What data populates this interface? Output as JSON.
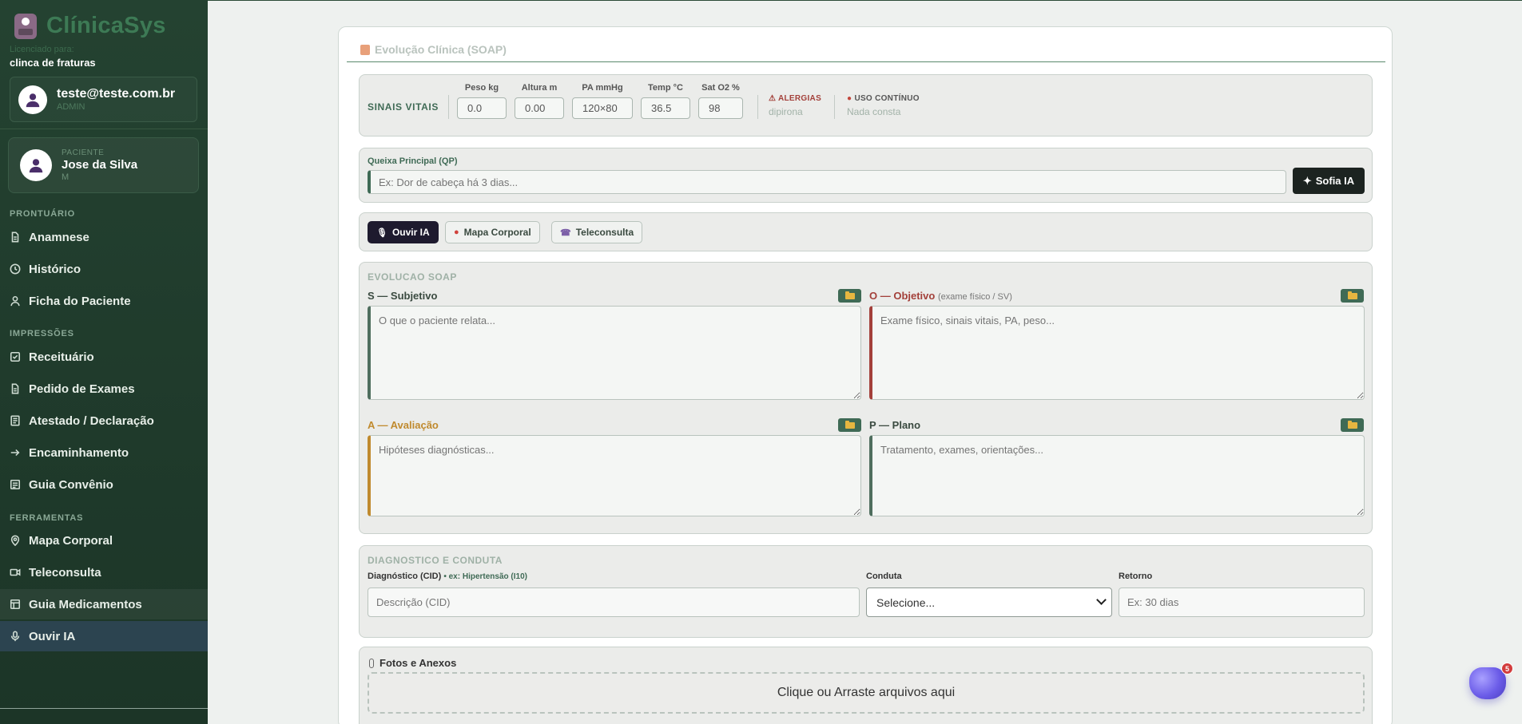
{
  "brand": {
    "name": "ClínicaSys",
    "licensed": "Licenciado para:",
    "clinic": "clinca de fraturas"
  },
  "user": {
    "email": "teste@teste.com.br",
    "role": "ADMIN"
  },
  "patient": {
    "label": "PACIENTE",
    "name": "Jose da Silva",
    "sex": "M"
  },
  "sidebar": {
    "sections": [
      "PRONTUÁRIO",
      "IMPRESSÕES",
      "FERRAMENTAS"
    ],
    "items": [
      {
        "label": "Anamnese",
        "icon": "document-icon"
      },
      {
        "label": "Histórico",
        "icon": "clock-icon"
      },
      {
        "label": "Ficha do Paciente",
        "icon": "user-icon"
      },
      {
        "label": "Receituário",
        "icon": "check-square-icon"
      },
      {
        "label": "Pedido de Exames",
        "icon": "document-icon"
      },
      {
        "label": "Atestado / Declaração",
        "icon": "file-text-icon"
      },
      {
        "label": "Encaminhamento",
        "icon": "arrow-right-icon"
      },
      {
        "label": "Guia Convênio",
        "icon": "list-icon"
      },
      {
        "label": "Mapa Corporal",
        "icon": "map-pin-icon"
      },
      {
        "label": "Teleconsulta",
        "icon": "video-icon"
      },
      {
        "label": "Guia Medicamentos",
        "icon": "table-icon"
      },
      {
        "label": "Ouvir IA",
        "icon": "mic-icon"
      }
    ]
  },
  "page": {
    "title": "Evolução Clínica (SOAP)"
  },
  "vitals": {
    "label": "SINAIS VITAIS",
    "fields": [
      {
        "label": "Peso kg",
        "value": "0.0"
      },
      {
        "label": "Altura m",
        "value": "0.00"
      },
      {
        "label": "PA mmHg",
        "value": "120×80"
      },
      {
        "label": "Temp °C",
        "value": "36.5"
      },
      {
        "label": "Sat O2 %",
        "value": "98"
      }
    ],
    "allergies_label": "⚠ ALERGIAS",
    "allergies_value": "dipirona",
    "continuous_label": "USO CONTÍNUO",
    "continuous_value": "Nada consta"
  },
  "qp": {
    "label": "Queixa Principal (QP)",
    "placeholder": "Ex: Dor de cabeça há 3 dias...",
    "sofia_button": "Sofia IA"
  },
  "tools": {
    "ouvir": "Ouvir IA",
    "mapa": "Mapa Corporal",
    "tele": "Teleconsulta"
  },
  "soap": {
    "heading": "EVOLUCAO SOAP",
    "s_label": "S — Subjetivo",
    "s_placeholder": "O que o paciente relata...",
    "o_label": "O — Objetivo",
    "o_sub": "(exame físico / SV)",
    "o_placeholder": "Exame físico, sinais vitais, PA, peso...",
    "a_label": "A — Avaliação",
    "a_placeholder": "Hipóteses diagnósticas...",
    "p_label": "P — Plano",
    "p_placeholder": "Tratamento, exames, orientações..."
  },
  "diag": {
    "heading": "DIAGNOSTICO E CONDUTA",
    "cid_label": "Diagnóstico (CID)",
    "cid_hint": "• ex: Hipertensão (I10)",
    "cid_placeholder": "Descrição (CID)",
    "conduta_label": "Conduta",
    "conduta_value": "Selecione...",
    "retorno_label": "Retorno",
    "retorno_placeholder": "Ex: 30 dias"
  },
  "fotos": {
    "title": "Fotos e Anexos",
    "dropzone": "Clique ou Arraste arquivos aqui"
  },
  "assistant": {
    "badge": "5"
  },
  "colors": {
    "sidebar": "#244231",
    "accent": "#3f6a55",
    "objective": "#a3403a",
    "assessment": "#c08a2e"
  }
}
